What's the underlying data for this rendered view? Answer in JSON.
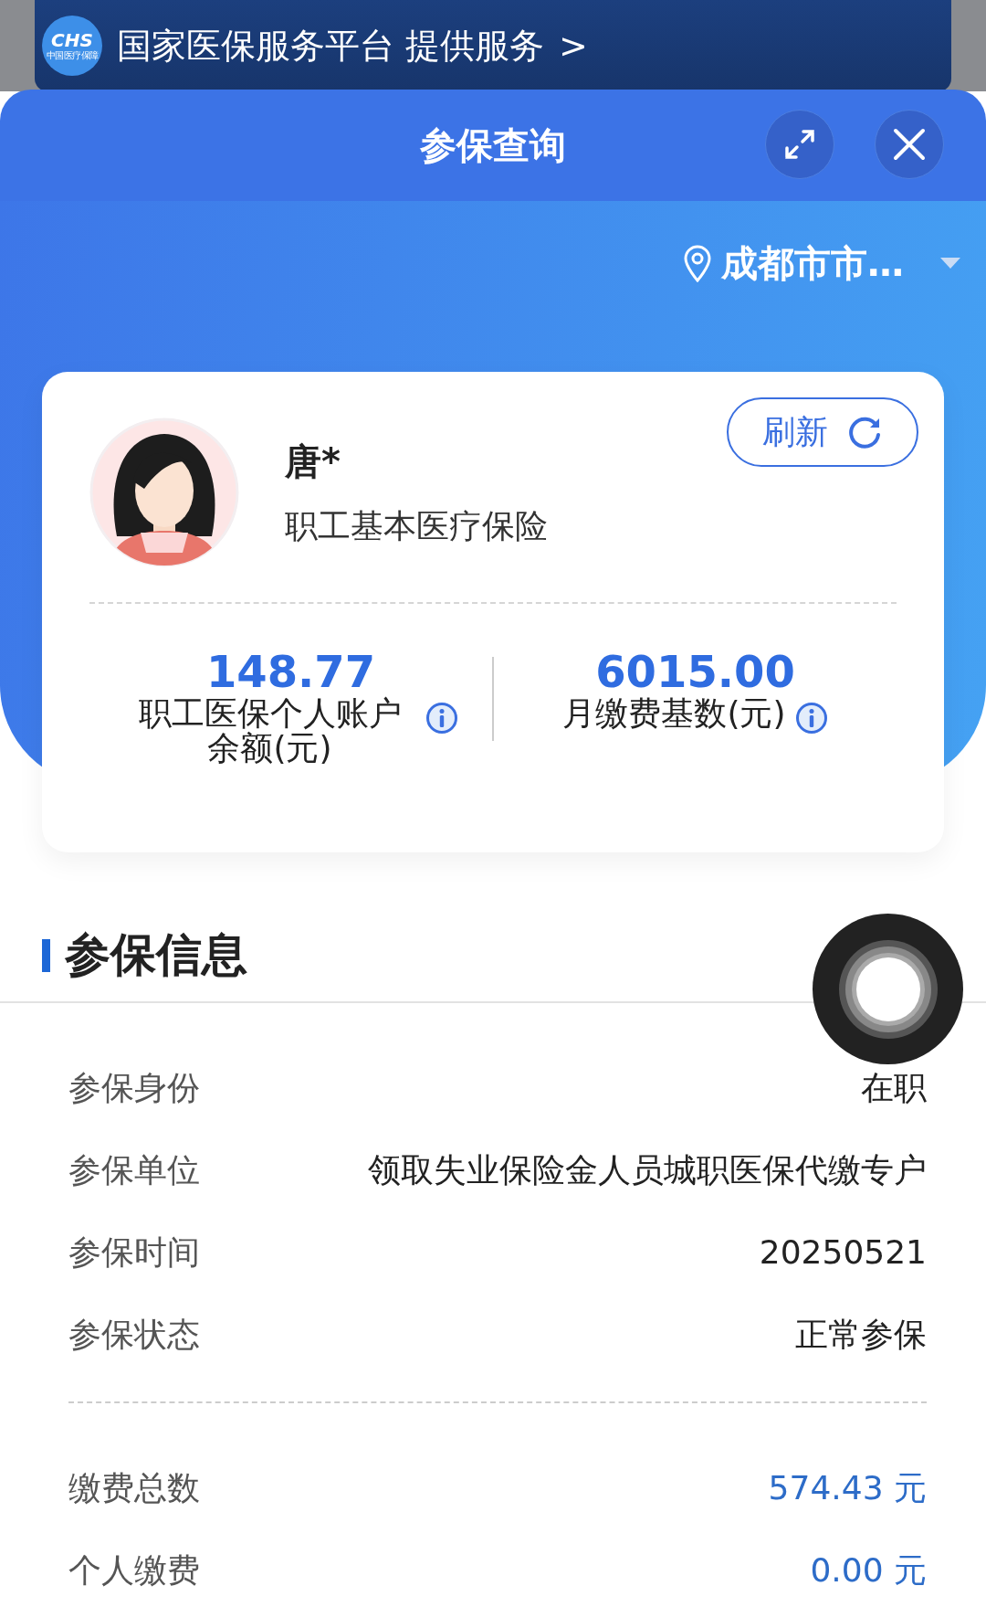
{
  "banner": {
    "logo_text": "CHS",
    "logo_subtext": "中国医疗保障",
    "text": "国家医保服务平台 提供服务",
    "chevron": ">"
  },
  "modal": {
    "title": "参保查询"
  },
  "location": {
    "text": "成都市市…"
  },
  "profile": {
    "name": "唐*",
    "insurance_type": "职工基本医疗保险",
    "refresh_label": "刷新"
  },
  "stats": [
    {
      "value": "148.77",
      "label": "职工医保个人账户余额(元)"
    },
    {
      "value": "6015.00",
      "label": "月缴费基数(元)"
    }
  ],
  "section": {
    "title": "参保信息"
  },
  "detail_groups": [
    [
      {
        "label": "参保身份",
        "value": "在职",
        "kind": "plain"
      },
      {
        "label": "参保单位",
        "value": "领取失业保险金人员城职医保代缴专户",
        "kind": "plain"
      },
      {
        "label": "参保时间",
        "value": "20250521",
        "kind": "plain"
      },
      {
        "label": "参保状态",
        "value": "正常参保",
        "kind": "plain"
      }
    ],
    [
      {
        "label": "缴费总数",
        "value": "574.43 元",
        "kind": "amount"
      },
      {
        "label": "个人缴费",
        "value": "0.00 元",
        "kind": "amount"
      }
    ]
  ]
}
